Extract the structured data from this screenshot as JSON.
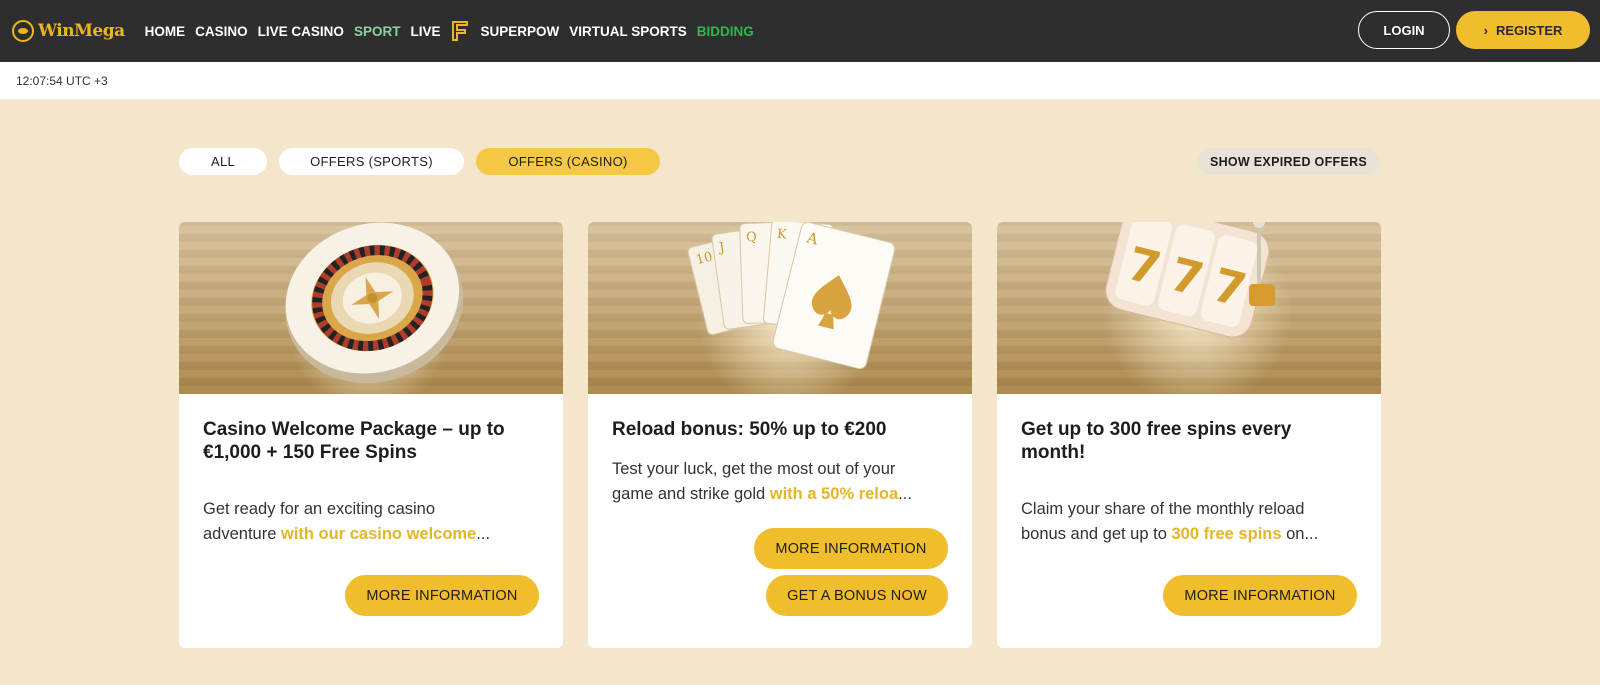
{
  "brand": {
    "name": "WinMega"
  },
  "nav": {
    "items": [
      {
        "label": "HOME"
      },
      {
        "label": "CASINO"
      },
      {
        "label": "LIVE CASINO"
      },
      {
        "label": "SPORT"
      },
      {
        "label": "LIVE"
      },
      {
        "label": "SUPERPOW"
      },
      {
        "label": "VIRTUAL SPORTS"
      },
      {
        "label": "BIDDING"
      }
    ]
  },
  "auth": {
    "login": "LOGIN",
    "register": "REGISTER"
  },
  "time": "12:07:54 UTC +3",
  "filters": {
    "all": "ALL",
    "sports": "OFFERS (SPORTS)",
    "casino": "OFFERS (CASINO)",
    "expired": "SHOW EXPIRED OFFERS"
  },
  "cards": [
    {
      "title": "Casino Welcome Package – up to €1,000 + 150 Free Spins",
      "desc_line1": "Get ready for an exciting casino",
      "desc_line2_pre": "adventure ",
      "desc_line2_hl": " with our casino welcome",
      "desc_line2_post": "...",
      "more": "MORE INFORMATION"
    },
    {
      "title": "Reload bonus: 50% up to €200",
      "desc_line1": "Test your luck, get the most out of your",
      "desc_line2_pre": "game and strike gold ",
      "desc_line2_hl": "with a 50% reloa",
      "desc_line2_post": "...",
      "more": "MORE INFORMATION",
      "bonus": "GET A BONUS NOW"
    },
    {
      "title": "Get up to 300 free spins every month!",
      "desc_line1": "Claim your share of the monthly reload",
      "desc_line2_pre": "bonus and get up to ",
      "desc_line2_hl": "300 free spins",
      "desc_line2_post": " on...",
      "more": "MORE INFORMATION"
    }
  ],
  "colors": {
    "accent": "#f0be2c",
    "topbar": "#2e2e2e",
    "background": "#f3e6cb",
    "sport": "#8fd19e",
    "bidding": "#2fb84a"
  },
  "icons": [
    "roulette-wheel-image",
    "playing-cards-image",
    "slot-machine-image",
    "superpow-icon",
    "chevron-right-icon"
  ]
}
